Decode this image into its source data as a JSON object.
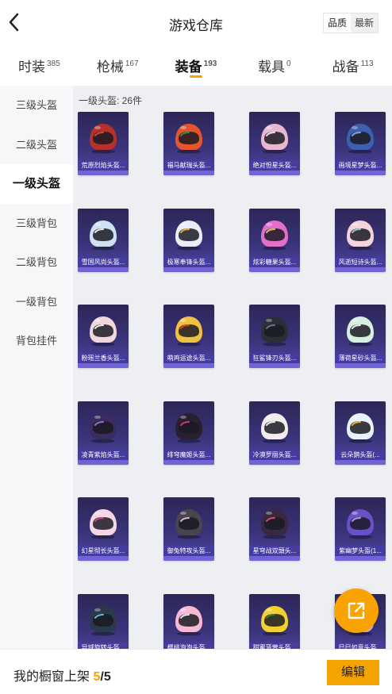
{
  "header": {
    "title": "游戏仓库",
    "sort_options": [
      "品质",
      "最新"
    ],
    "active_sort": "品质"
  },
  "tabs": [
    {
      "label": "时装",
      "count": "385"
    },
    {
      "label": "枪械",
      "count": "167"
    },
    {
      "label": "装备",
      "count": "193"
    },
    {
      "label": "载具",
      "count": "0"
    },
    {
      "label": "战备",
      "count": "113"
    }
  ],
  "active_tab": "装备",
  "sidebar": {
    "items": [
      "三级头盔",
      "二级头盔",
      "一级头盔",
      "三级背包",
      "二级背包",
      "一级背包",
      "背包挂件"
    ],
    "active": "一级头盔"
  },
  "section": {
    "title": "一级头盔: 26件"
  },
  "items": [
    {
      "name": "荒原烈焰头盔...",
      "color": "#b5302a",
      "accent": "#e0503a"
    },
    {
      "name": "福马献瑞头盔...",
      "color": "#e2552d",
      "accent": "#3a9a4a"
    },
    {
      "name": "绝对怛星头盔...",
      "color": "#e8b8d0",
      "accent": "#ffffff"
    },
    {
      "name": "画境星梦头盔...",
      "color": "#3d5fb0",
      "accent": "#8fb3ea"
    },
    {
      "name": "雪国风尚头盔...",
      "color": "#cfe0f2",
      "accent": "#ffffff"
    },
    {
      "name": "极寒奉锋头盔...",
      "color": "#e8eef8",
      "accent": "#f2c23a"
    },
    {
      "name": "炫彩糖果头盔...",
      "color": "#e26fc8",
      "accent": "#f5d24a"
    },
    {
      "name": "风逝短诗头盔...",
      "color": "#f2d3de",
      "accent": "#9fd3e0"
    },
    {
      "name": "粉瑶兰香头盔...",
      "color": "#f1d7dc",
      "accent": "#ffffff"
    },
    {
      "name": "萌鸡运途头盔...",
      "color": "#f0c040",
      "accent": "#d94a3a"
    },
    {
      "name": "狂鲨锋刃头盔...",
      "color": "#2d2f38",
      "accent": "#7a8090"
    },
    {
      "name": "薄荷星砂头盔...",
      "color": "#d6efe0",
      "accent": "#ffffff"
    },
    {
      "name": "凌青紫焰头盔...",
      "color": "#3a2c60",
      "accent": "#9a7fd8"
    },
    {
      "name": "绯穹魔姬头盔...",
      "color": "#2b2030",
      "accent": "#d8407a"
    },
    {
      "name": "冷漠罗丽头盔...",
      "color": "#f3ecef",
      "accent": "#ffffff"
    },
    {
      "name": "云朵鹅头盔(...",
      "color": "#e8f2fa",
      "accent": "#f2c23a"
    },
    {
      "name": "幻星彻长头盔...",
      "color": "#f4d6e6",
      "accent": "#d84a8a"
    },
    {
      "name": "御兔特攻头盔...",
      "color": "#4a4450",
      "accent": "#f0c8d8"
    },
    {
      "name": "星穹战双頭头...",
      "color": "#3a2840",
      "accent": "#e05a7a"
    },
    {
      "name": "紫幽梦头盔(1...",
      "color": "#6a50c8",
      "accent": "#b9a8f2"
    },
    {
      "name": "异域旋转头盔...",
      "color": "#2a3a4a",
      "accent": "#6ad0e8"
    },
    {
      "name": "樱桃泡泡头盔...",
      "color": "#f6b8d2",
      "accent": "#ffffff"
    },
    {
      "name": "甜蜜菠萝头盔...",
      "color": "#f2d030",
      "accent": "#3a8a3a"
    },
    {
      "name": "巳巳如意头盔...",
      "color": "#f0c8d8",
      "accent": "#e05a7a"
    }
  ],
  "bottom": {
    "label": "我的橱窗上架",
    "current": "5",
    "total": "/5",
    "edit_label": "编辑"
  },
  "icons": {
    "back": "back-chevron-icon",
    "share": "share-export-icon",
    "item": "helmet-icon"
  },
  "colors": {
    "accent": "#f5a300",
    "card_bg": "#3a3379",
    "card_label": "#463ca0"
  }
}
